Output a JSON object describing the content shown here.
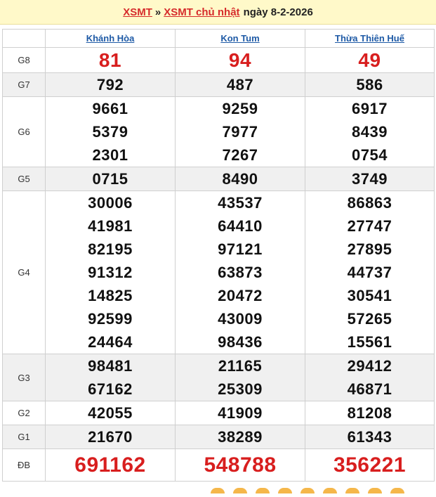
{
  "header": {
    "link1": "XSMT",
    "separator": "»",
    "link2": "XSMT chủ nhật",
    "date_text": "ngày 8-2-2026"
  },
  "provinces": [
    "Khánh Hòa",
    "Kon Tum",
    "Thừa Thiên Huế"
  ],
  "rows": [
    {
      "label": "G8",
      "values": [
        [
          "81"
        ],
        [
          "94"
        ],
        [
          "49"
        ]
      ]
    },
    {
      "label": "G7",
      "values": [
        [
          "792"
        ],
        [
          "487"
        ],
        [
          "586"
        ]
      ]
    },
    {
      "label": "G6",
      "values": [
        [
          "9661",
          "5379",
          "2301"
        ],
        [
          "9259",
          "7977",
          "7267"
        ],
        [
          "6917",
          "8439",
          "0754"
        ]
      ]
    },
    {
      "label": "G5",
      "values": [
        [
          "0715"
        ],
        [
          "8490"
        ],
        [
          "3749"
        ]
      ]
    },
    {
      "label": "G4",
      "values": [
        [
          "30006",
          "41981",
          "82195",
          "91312",
          "14825",
          "92599",
          "24464"
        ],
        [
          "43537",
          "64410",
          "97121",
          "63873",
          "20472",
          "43009",
          "98436"
        ],
        [
          "86863",
          "27747",
          "27895",
          "44737",
          "30541",
          "57265",
          "15561"
        ]
      ]
    },
    {
      "label": "G3",
      "values": [
        [
          "98481",
          "67162"
        ],
        [
          "21165",
          "25309"
        ],
        [
          "29412",
          "46871"
        ]
      ]
    },
    {
      "label": "G2",
      "values": [
        [
          "42055"
        ],
        [
          "41909"
        ],
        [
          "81208"
        ]
      ]
    },
    {
      "label": "G1",
      "values": [
        [
          "21670"
        ],
        [
          "38289"
        ],
        [
          "61343"
        ]
      ]
    },
    {
      "label": "ĐB",
      "values": [
        [
          "691162"
        ],
        [
          "548788"
        ],
        [
          "356221"
        ]
      ]
    }
  ]
}
